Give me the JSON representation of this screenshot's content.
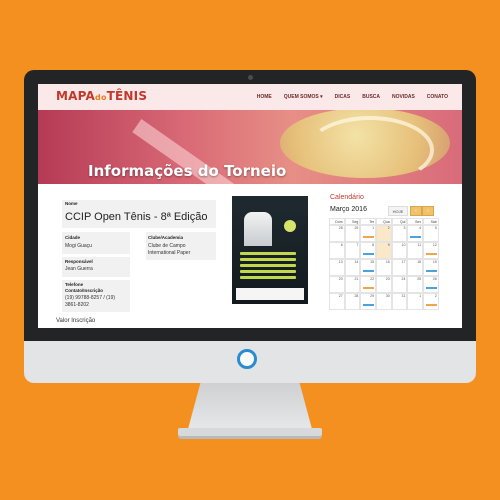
{
  "logo": {
    "part1": "MAPA",
    "part2": "do",
    "part3": "TÊNIS"
  },
  "nav": {
    "items": [
      "HOME",
      "QUEM SOMOS ▾",
      "DICAS",
      "BUSCA",
      "NOVIDAS",
      "CONATO"
    ]
  },
  "hero": {
    "title": "Informações do Torneio"
  },
  "tournament": {
    "name_label": "Nome",
    "name": "CCIP Open Tênis - 8ª Edição",
    "city_label": "Cidade",
    "city": "Mogi Guaçu",
    "club_label": "Clube/Academia",
    "club_line1": "Clube de Campo",
    "club_line2": "International Paper",
    "responsible_label": "Responsável",
    "responsible": "Jean Guerra",
    "phone_label_line1": "Telefone",
    "phone_label_line2": "Contato/Inscrição",
    "phone_line1": "(19) 99788-8257 / (19)",
    "phone_line2": "3861-8202",
    "fee_label": "Valor Inscrição"
  },
  "calendar": {
    "title": "Calendário",
    "month": "Março 2016",
    "today_label": "HOJE",
    "prev_icon": "chevron-left-icon",
    "next_icon": "chevron-right-icon",
    "weekdays": [
      "Dom",
      "Seg",
      "Ter",
      "Qua",
      "Qui",
      "Sex",
      "Sáb"
    ],
    "weeks": [
      [
        "28",
        "29",
        "1",
        "2",
        "3",
        "4",
        "5"
      ],
      [
        "6",
        "7",
        "8",
        "9",
        "10",
        "11",
        "12"
      ],
      [
        "13",
        "14",
        "15",
        "16",
        "17",
        "18",
        "19"
      ],
      [
        "20",
        "21",
        "22",
        "23",
        "24",
        "25",
        "26"
      ],
      [
        "27",
        "28",
        "29",
        "30",
        "31",
        "1",
        "2"
      ]
    ]
  }
}
